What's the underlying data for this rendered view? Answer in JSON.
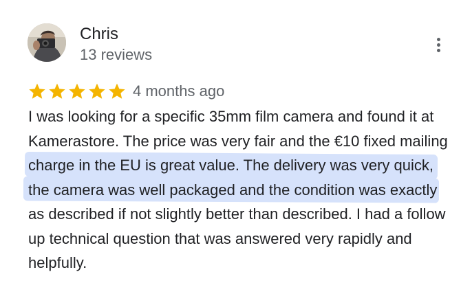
{
  "reviewer": {
    "name": "Chris",
    "review_count": "13 reviews",
    "avatar": "avatar-photo"
  },
  "menu": {
    "icon": "more-vert-icon"
  },
  "rating": {
    "stars": 5,
    "max_stars": 5,
    "icon": "star-icon",
    "color": "#f4b400"
  },
  "review": {
    "date": "4 months ago",
    "text_before": "I was looking for a specific 35mm film camera and found it at Kamerastore. The price was very fair and the ",
    "text_highlighted": "€10 fixed mailing charge in the EU is great value. The delivery was very quick, the camera was well packaged",
    "text_after": " and the condition was exactly as described if not slightly better than described. I had a follow up technical question that was answered very rapidly and helpfully.",
    "highlight_color": "#d6e2fb"
  }
}
